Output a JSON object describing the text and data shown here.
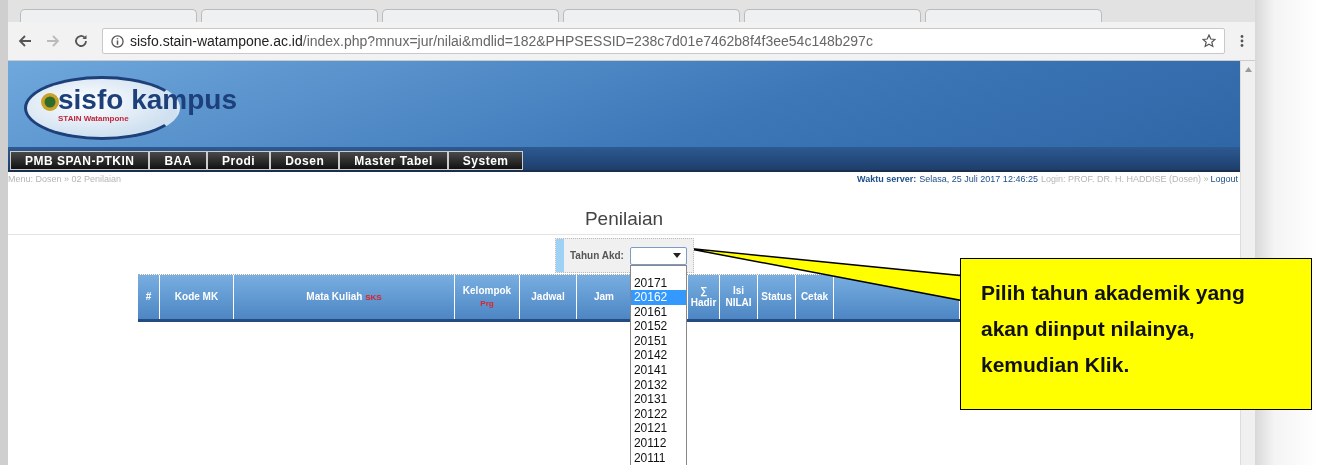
{
  "browser": {
    "url_host": "sisfo.stain-watampone.ac.id",
    "url_path": "/index.php?mnux=jur/nilai&mdlid=182&PHPSESSID=238c7d01e7462b8f4f3ee54c148b297c"
  },
  "header": {
    "logo_title": "sisfo kampus",
    "logo_subtitle": "STAIN Watampone"
  },
  "menu": [
    "PMB SPAN-PTKIN",
    "BAA",
    "Prodi",
    "Dosen",
    "Master Tabel",
    "System"
  ],
  "info_bar": {
    "breadcrumb": "Menu: Dosen » 02 Penilaian",
    "server_label": "Waktu server:",
    "server_time": "Selasa, 25 Juli 2017 12:46:25",
    "login": "Login: PROF. DR. H. HADDISE (Dosen) »",
    "logout": "Logout"
  },
  "heading": "Penilaian",
  "filter": {
    "label": "Tahun Akd:",
    "options": [
      {
        "label": "20171",
        "selected": false
      },
      {
        "label": "20162",
        "selected": true
      },
      {
        "label": "20161",
        "selected": false
      },
      {
        "label": "20152",
        "selected": false
      },
      {
        "label": "20151",
        "selected": false
      },
      {
        "label": "20142",
        "selected": false
      },
      {
        "label": "20141",
        "selected": false
      },
      {
        "label": "20132",
        "selected": false
      },
      {
        "label": "20131",
        "selected": false
      },
      {
        "label": "20122",
        "selected": false
      },
      {
        "label": "20121",
        "selected": false
      },
      {
        "label": "20112",
        "selected": false
      },
      {
        "label": "20111",
        "selected": false
      }
    ]
  },
  "table": {
    "columns": [
      {
        "label": "#"
      },
      {
        "label": "Kode MK"
      },
      {
        "label": "Mata Kuliah",
        "note": "SKS",
        "kind": "inline_note"
      },
      {
        "label": "Kelompok",
        "note": "Prg",
        "kind": "stacked_note"
      },
      {
        "label": "Jadwal"
      },
      {
        "label": "Jam"
      },
      {},
      {
        "label": "∑\nHadir"
      },
      {
        "label": "Isi\nNILAI"
      },
      {
        "label": "Status"
      },
      {
        "label": "Cetak"
      },
      {}
    ]
  },
  "callout": {
    "text": "Pilih tahun akademik yang akan diinput nilainya, kemudian Klik."
  }
}
